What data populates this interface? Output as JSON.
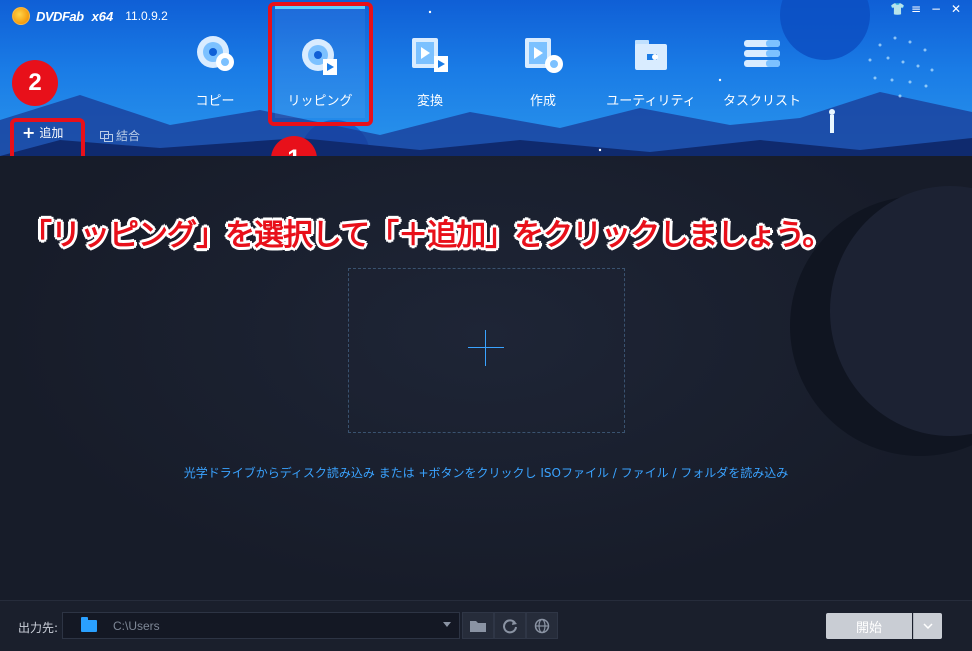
{
  "app": {
    "name": "DVDFab",
    "arch": "x64",
    "version": "11.0.9.2"
  },
  "window_controls": {
    "shirt": "👕",
    "menu": "≡",
    "minimize": "−",
    "close": "✕"
  },
  "nav": {
    "items": [
      {
        "label": "コピー",
        "icon": "disc-copy-icon"
      },
      {
        "label": "リッピング",
        "icon": "disc-rip-icon",
        "active": true
      },
      {
        "label": "変換",
        "icon": "video-convert-icon"
      },
      {
        "label": "作成",
        "icon": "video-create-icon"
      },
      {
        "label": "ユーティリティ",
        "icon": "toolbox-icon"
      },
      {
        "label": "タスクリスト",
        "icon": "task-list-icon"
      }
    ]
  },
  "toolbar": {
    "add_label": "追加",
    "merge_label": "結合"
  },
  "annotations": {
    "badge_1": "1",
    "badge_2": "2",
    "instruction": "「リッピング」を選択して「＋追加」をクリックしましょう。"
  },
  "main": {
    "hint": "光学ドライブからディスク読み込み または +ボタンをクリックし ISOファイル / ファイル / フォルダを読み込み"
  },
  "footer": {
    "output_label": "出力先:",
    "output_path": "C:\\Users",
    "start_label": "開始"
  },
  "colors": {
    "accent": "#3aa3ff",
    "highlight": "#e8101a",
    "header": "#1a7ce6"
  }
}
